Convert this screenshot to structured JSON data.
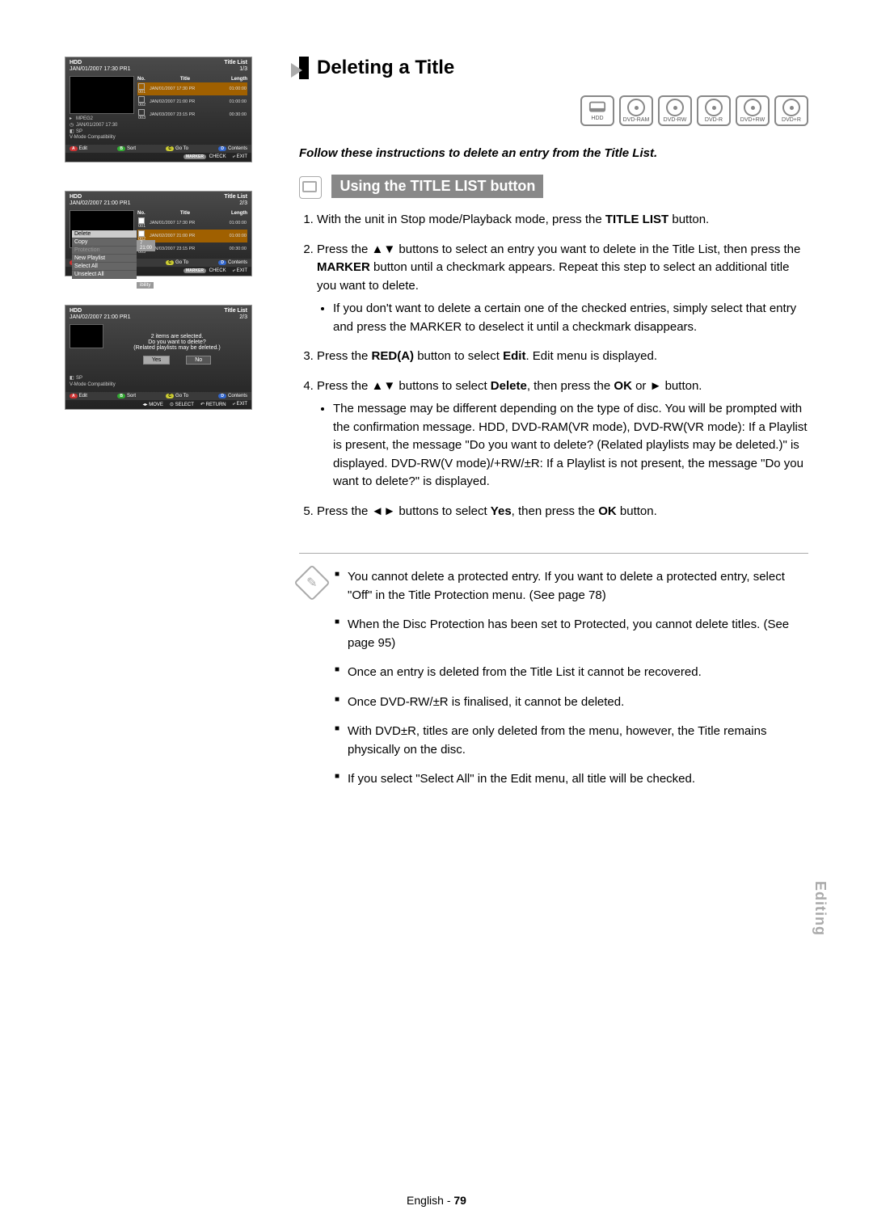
{
  "screenshots": {
    "common": {
      "hdd_label": "HDD",
      "title_list": "Title List",
      "headers": {
        "no": "No.",
        "title": "Title",
        "length": "Length"
      },
      "footer": {
        "edit": "Edit",
        "sort": "Sort",
        "goto": "Go To",
        "contents": "Contents",
        "marker": "MARKER",
        "check": "CHECK",
        "exit": "EXIT",
        "move": "MOVE",
        "select": "SELECT",
        "return": "RETURN"
      },
      "rows": [
        {
          "no": "001",
          "title": "JAN/01/2007 17:30 PR",
          "length": "01:00:00"
        },
        {
          "no": "002",
          "title": "JAN/02/2007 21:00 PR",
          "length": "01:00:00"
        },
        {
          "no": "003",
          "title": "JAN/03/2007 23:15 PR",
          "length": "00:30:00"
        }
      ]
    },
    "panel1": {
      "subtitle": "JAN/01/2007 17:30 PR1",
      "counter": "1/3",
      "meta": {
        "mode": "MPEG2",
        "date": "JAN/01/2007 17:30",
        "sp": "SP",
        "vmode": "V-Mode Compatibility"
      }
    },
    "panel2": {
      "subtitle": "JAN/02/2007 21:00 PR1",
      "counter": "2/3",
      "context_items": [
        "Delete",
        "Copy",
        "Protection",
        "New Playlist",
        "Select All",
        "Unselect All"
      ],
      "ctx_sub": "7 21:00",
      "ctx_vmode": "ibility"
    },
    "panel3": {
      "subtitle": "JAN/02/2007 21:00 PR1",
      "counter": "2/3",
      "dialog": {
        "l1": "2 items are selected.",
        "l2": "Do you want to delete?",
        "l3": "(Related playlists may be deleted.)",
        "yes": "Yes",
        "no": "No"
      },
      "meta": {
        "sp": "SP",
        "vmode": "V-Mode Compatibility"
      }
    }
  },
  "section": {
    "title": "Deleting a Title",
    "discs": [
      "HDD",
      "DVD-RAM",
      "DVD-RW",
      "DVD-R",
      "DVD+RW",
      "DVD+R"
    ],
    "intro": "Follow these instructions to delete an entry from the Title List.",
    "subheading": "Using the TITLE LIST button",
    "steps": [
      {
        "pre": "With the unit in Stop mode/Playback mode, press the ",
        "bold": "TITLE LIST",
        "post": " button."
      },
      {
        "pre": "Press the ▲▼ buttons to select an entry you want to delete in the Title List, then press the ",
        "bold": "MARKER",
        "post": " button until a checkmark appears. Repeat this step to select an additional title you want to delete.",
        "bullets": [
          "If you don't want to delete a certain one of the checked entries, simply select that entry and press the MARKER to deselect it until a checkmark disappears."
        ]
      },
      {
        "pre": "Press the ",
        "bold": "RED(A)",
        "mid": " button to select ",
        "bold2": "Edit",
        "post": ". Edit menu is displayed."
      },
      {
        "pre": "Press the ▲▼ buttons to select ",
        "bold": "Delete",
        "mid": ", then press the ",
        "bold2": "OK",
        "post": " or ► button.",
        "bullets": [
          "The message may be different depending on the type of disc. You will be prompted with the confirmation  message. HDD, DVD-RAM(VR mode), DVD-RW(VR mode): If a Playlist is present, the message \"Do you want to delete? (Related playlists may be deleted.)\" is displayed. DVD-RW(V mode)/+RW/±R: If a Playlist is not present, the message \"Do you want to delete?\" is displayed."
        ]
      },
      {
        "pre": "Press the ◄► buttons to select ",
        "bold": "Yes",
        "mid": ", then press the ",
        "bold2": "OK",
        "post": " button."
      }
    ],
    "notes": [
      "You cannot delete a protected entry. If you want to delete a protected entry, select \"Off\" in the Title Protection menu. (See page 78)",
      "When the Disc Protection has been set to Protected, you cannot delete titles. (See page 95)",
      "Once an entry is deleted from the Title List it cannot be recovered.",
      "Once DVD-RW/±R is finalised, it cannot be deleted.",
      "With DVD±R, titles are only deleted from the menu, however, the Title remains physically on the disc.",
      "If you select \"Select All\" in the Edit menu, all title will be checked."
    ]
  },
  "side_tab": "Editing",
  "footer": {
    "lang": "English -",
    "page": "79"
  }
}
